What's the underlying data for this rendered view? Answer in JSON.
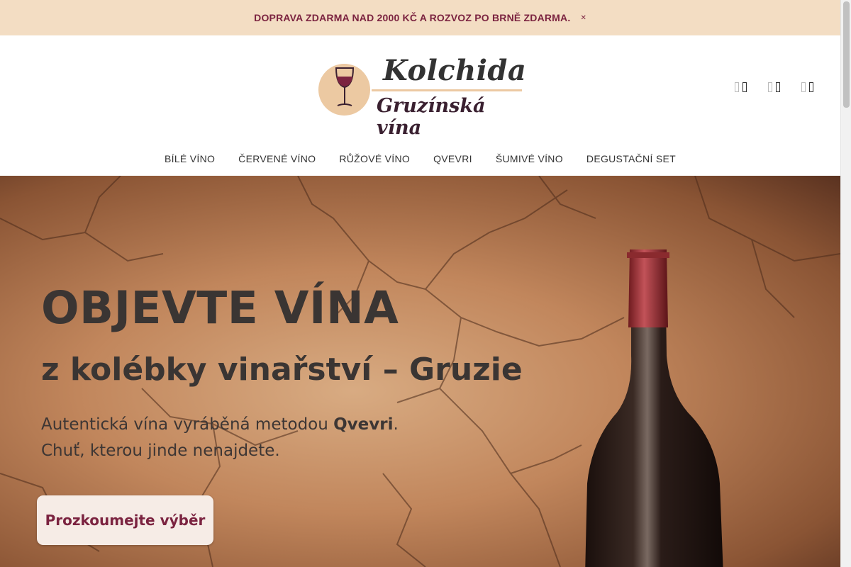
{
  "announcement": {
    "text": "DOPRAVA ZDARMA NAD 2000 KČ A ROZVOZ PO BRNĚ ZDARMA.",
    "close_icon": "close-icon"
  },
  "logo": {
    "brand": "Kolchida",
    "tagline": "Gruzínská vína"
  },
  "header_icons": [
    "search-icon",
    "user-icon",
    "cart-icon"
  ],
  "nav": {
    "items": [
      {
        "label": "BÍLÉ VÍNO"
      },
      {
        "label": "ČERVENÉ VÍNO"
      },
      {
        "label": "RŮŽOVÉ VÍNO"
      },
      {
        "label": "QVEVRI"
      },
      {
        "label": "ŠUMIVÉ VÍNO"
      },
      {
        "label": "DEGUSTAČNÍ SET"
      }
    ]
  },
  "hero": {
    "headline": "OBJEVTE VÍNA",
    "subheadline": "z kolébky vinařství – Gruzie",
    "line1_pre": "Autentická vína vyráběná metodou ",
    "line1_bold": "Qvevri",
    "line1_post": ".",
    "line2": "Chuť, kterou jinde nenajdete.",
    "cta_label": "Prozkoumejte výběr"
  },
  "colors": {
    "announcement_bg": "#f3ddc3",
    "accent": "#7b2340",
    "logo_circle": "#ecc9a2"
  }
}
